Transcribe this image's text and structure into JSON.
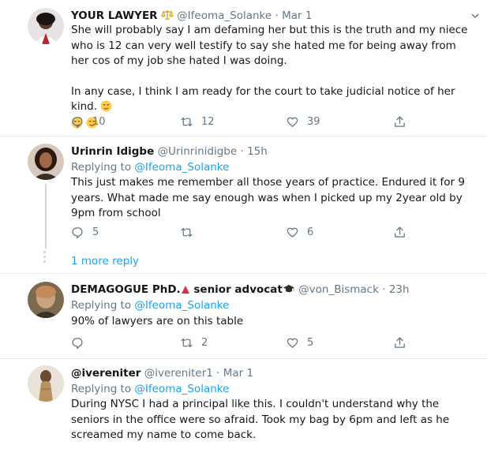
{
  "tweets": [
    {
      "name": "YOUR LAWYER",
      "badge_icon": "scales-icon",
      "handle": "@Ifeoma_Solanke",
      "time": "Mar 1",
      "text1": "She will probably say I am defaming her but this is the truth and my niece who is 12 can very well testify to say she hated me for being away from her cos of my job she hated I was doing.",
      "text2": "In any case, I think I am ready for the court to take judicial notice of her kind.",
      "reply_count": "10",
      "retweet_count": "12",
      "like_count": "39"
    },
    {
      "name": "Urinrin Idigbe",
      "handle": "@Urinrinidigbe",
      "time": "15h",
      "replying_prefix": "Replying to",
      "replying_to": "@Ifeoma_Solanke",
      "text": "This just makes me remember all those years of practice. Endured it for 9 years. What made me say enough was when I picked up my 2year old by 9pm from school",
      "reply_count": "5",
      "retweet_count": "",
      "like_count": "6"
    },
    {
      "more_replies": "1 more reply"
    },
    {
      "name": "DEMAGOGUE PhD.",
      "name_suffix": "senior advocat",
      "handle": "@von_Bismack",
      "time": "23h",
      "replying_prefix": "Replying to",
      "replying_to": "@Ifeoma_Solanke",
      "text": "90% of lawyers are on this table",
      "reply_count": "",
      "retweet_count": "2",
      "like_count": "5"
    },
    {
      "name": "@ivereniter",
      "handle": "@ivereniter1",
      "time": "Mar 1",
      "replying_prefix": "Replying to",
      "replying_to": "@Ifeoma_Solanke",
      "text": "During NYSC I had a principal like this. I couldn't understand why the seniors in the office were so afraid. Took my bag by 6pm and left as he screamed my name to come back."
    }
  ],
  "colors": {
    "link": "#1da1f2",
    "secondary_text": "#657786",
    "divider": "#e6ecf0"
  }
}
